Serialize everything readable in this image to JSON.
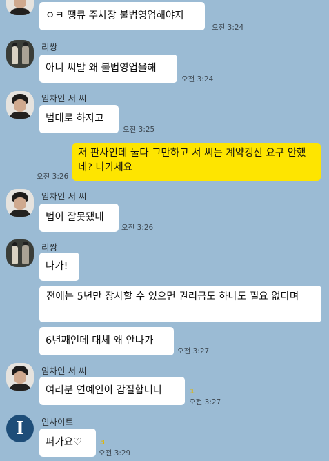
{
  "chat": {
    "messages": [
      {
        "sender": "",
        "text": "ㅇㅋ 땡큐 주차장 불법영업해야지",
        "time": "오전 3:24"
      },
      {
        "sender": "리쌍",
        "text": "아니 씨발 왜 불법영업을해",
        "time": "오전 3:24"
      },
      {
        "sender": "임차인 서 씨",
        "text": "법대로 하자고",
        "time": "오전 3:25"
      },
      {
        "sender": "me",
        "text": "저 판사인데 둘다 그만하고 서 씨는 계약갱신 요구 안했네? 나가세요",
        "time": "오전 3:26"
      },
      {
        "sender": "임차인 서 씨",
        "text": "법이 잘못됐네",
        "time": "오전 3:26"
      },
      {
        "sender": "리쌍",
        "text": "나가!",
        "time": ""
      },
      {
        "sender": "리쌍",
        "text": "전에는 5년만 장사할 수 있으면 권리금도 하나도 필요 없다며",
        "time": ""
      },
      {
        "sender": "리쌍",
        "text": "6년째인데 대체 왜 안나가",
        "time": "오전 3:27"
      },
      {
        "sender": "임차인 서 씨",
        "text": "여러분 연예인이 갑질합니다",
        "time": "오전 3:27",
        "unread": "1"
      },
      {
        "sender": "인사이트",
        "text": "퍼가요♡",
        "time": "오전 3:29",
        "unread": "3"
      }
    ],
    "senders": {
      "lee": "리쌍",
      "lim": "임차인 서 씨",
      "insight": "인사이트"
    },
    "avatars": {
      "insight_mark": "I"
    },
    "colors": {
      "background": "#9bbbd4",
      "bubble_other": "#ffffff",
      "bubble_mine": "#fee500",
      "unread": "#e2b600"
    }
  }
}
